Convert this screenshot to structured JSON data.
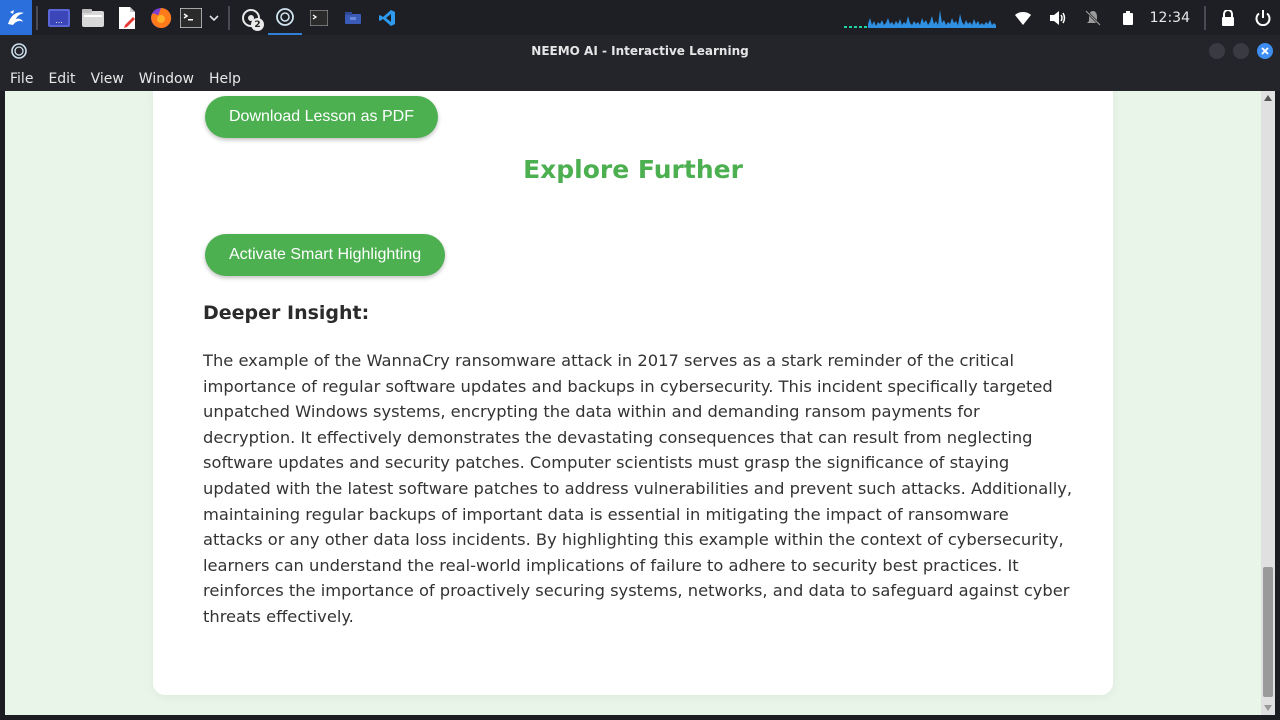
{
  "taskbar": {
    "clock": "12:34",
    "badge_count": "2"
  },
  "window": {
    "title": "NEEMO AI - Interactive Learning"
  },
  "menu": {
    "file": "File",
    "edit": "Edit",
    "view": "View",
    "window": "Window",
    "help": "Help"
  },
  "content": {
    "download_button": "Download Lesson as PDF",
    "explore_title": "Explore Further",
    "highlight_button": "Activate Smart Highlighting",
    "insight_title": "Deeper Insight:",
    "insight_body": "The example of the WannaCry ransomware attack in 2017 serves as a stark reminder of the critical importance of regular software updates and backups in cybersecurity. This incident specifically targeted unpatched Windows systems, encrypting the data within and demanding ransom payments for decryption. It effectively demonstrates the devastating consequences that can result from neglecting software updates and security patches. Computer scientists must grasp the significance of staying updated with the latest software patches to address vulnerabilities and prevent such attacks. Additionally, maintaining regular backups of important data is essential in mitigating the impact of ransomware attacks or any other data loss incidents. By highlighting this example within the context of cybersecurity, learners can understand the real-world implications of failure to adhere to security best practices. It reinforces the importance of proactively securing systems, networks, and data to safeguard against cyber threats effectively."
  },
  "colors": {
    "accent_green": "#4caf50",
    "page_background": "#e9f5e9",
    "taskbar": "#1e1f24",
    "active_indicator": "#2f7fd9"
  },
  "icons": {
    "launcher": "kali-dragon-icon",
    "taskbar_apps": [
      "workspace-icon",
      "file-manager-icon",
      "text-editor-icon",
      "firefox-icon",
      "terminal-icon",
      "chevron-down-icon",
      "chatgpt-notification-icon",
      "neemo-app-icon",
      "terminal-window-icon",
      "folder-window-icon",
      "vscode-icon"
    ],
    "tray": [
      "wifi-icon",
      "volume-icon",
      "notifications-muted-icon",
      "battery-icon",
      "lock-icon",
      "power-icon"
    ]
  }
}
